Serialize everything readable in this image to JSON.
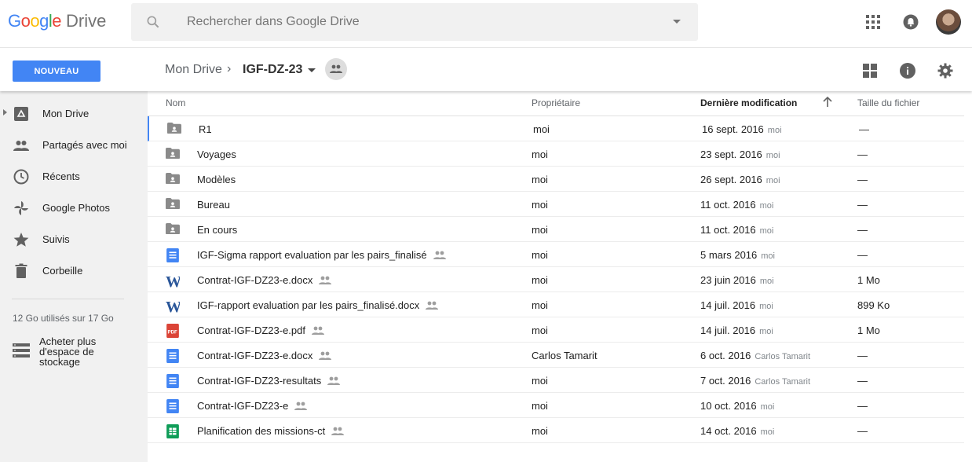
{
  "app": {
    "logo_google": "Google",
    "logo_drive": "Drive"
  },
  "search": {
    "placeholder": "Rechercher dans Google Drive"
  },
  "toolbar": {
    "new_label": "NOUVEAU",
    "breadcrumb_root": "Mon Drive",
    "breadcrumb_sep": "›",
    "breadcrumb_current": "IGF-DZ-23"
  },
  "sidebar": {
    "items": [
      {
        "label": "Mon Drive",
        "icon": "drive-icon"
      },
      {
        "label": "Partagés avec moi",
        "icon": "people-icon"
      },
      {
        "label": "Récents",
        "icon": "clock-icon"
      },
      {
        "label": "Google Photos",
        "icon": "pinwheel-icon"
      },
      {
        "label": "Suivis",
        "icon": "star-icon"
      },
      {
        "label": "Corbeille",
        "icon": "trash-icon"
      }
    ],
    "storage_text": "12 Go utilisés sur 17 Go",
    "buy_storage": "Acheter plus d'espace de stockage"
  },
  "table": {
    "headers": {
      "name": "Nom",
      "owner": "Propriétaire",
      "modified": "Dernière modification",
      "size": "Taille du fichier"
    },
    "rows": [
      {
        "type": "folder",
        "name": "R1",
        "shared": false,
        "owner": "moi",
        "date": "16 sept. 2016",
        "by": "moi",
        "size": "—"
      },
      {
        "type": "folder",
        "name": "Voyages",
        "shared": false,
        "owner": "moi",
        "date": "23 sept. 2016",
        "by": "moi",
        "size": "—"
      },
      {
        "type": "folder",
        "name": "Modèles",
        "shared": false,
        "owner": "moi",
        "date": "26 sept. 2016",
        "by": "moi",
        "size": "—"
      },
      {
        "type": "folder",
        "name": "Bureau",
        "shared": false,
        "owner": "moi",
        "date": "11 oct. 2016",
        "by": "moi",
        "size": "—"
      },
      {
        "type": "folder",
        "name": "En cours",
        "shared": false,
        "owner": "moi",
        "date": "11 oct. 2016",
        "by": "moi",
        "size": "—"
      },
      {
        "type": "doc",
        "name": "IGF-Sigma rapport evaluation par les pairs_finalisé",
        "shared": true,
        "owner": "moi",
        "date": "5 mars 2016",
        "by": "moi",
        "size": "—"
      },
      {
        "type": "word",
        "name": "Contrat-IGF-DZ23-e.docx",
        "shared": true,
        "owner": "moi",
        "date": "23 juin 2016",
        "by": "moi",
        "size": "1 Mo"
      },
      {
        "type": "word",
        "name": "IGF-rapport evaluation par les pairs_finalisé.docx",
        "shared": true,
        "owner": "moi",
        "date": "14 juil. 2016",
        "by": "moi",
        "size": "899 Ko"
      },
      {
        "type": "pdf",
        "name": "Contrat-IGF-DZ23-e.pdf",
        "shared": true,
        "owner": "moi",
        "date": "14 juil. 2016",
        "by": "moi",
        "size": "1 Mo"
      },
      {
        "type": "doc",
        "name": "Contrat-IGF-DZ23-e.docx",
        "shared": true,
        "owner": "Carlos Tamarit",
        "date": "6 oct. 2016",
        "by": "Carlos Tamarit",
        "size": "—"
      },
      {
        "type": "doc",
        "name": "Contrat-IGF-DZ23-resultats",
        "shared": true,
        "owner": "moi",
        "date": "7 oct. 2016",
        "by": "Carlos Tamarit",
        "size": "—"
      },
      {
        "type": "doc",
        "name": "Contrat-IGF-DZ23-e",
        "shared": true,
        "owner": "moi",
        "date": "10 oct. 2016",
        "by": "moi",
        "size": "—"
      },
      {
        "type": "sheet",
        "name": "Planification des missions-ct",
        "shared": true,
        "owner": "moi",
        "date": "14 oct. 2016",
        "by": "moi",
        "size": "—"
      }
    ]
  },
  "colors": {
    "accent": "#4285f4",
    "sidebar_bg": "#f1f1f1",
    "pdf": "#db4437",
    "sheet": "#0f9d58"
  }
}
